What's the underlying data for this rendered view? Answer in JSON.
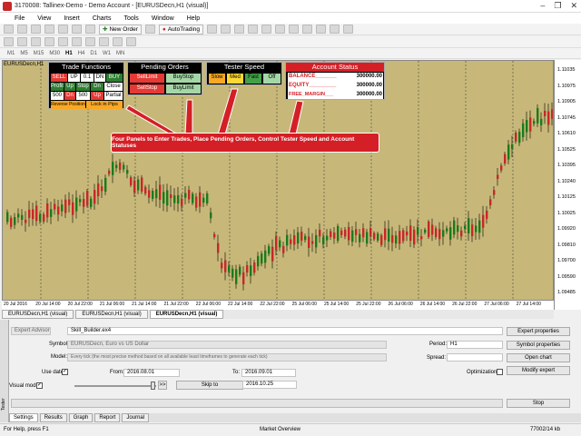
{
  "window": {
    "title": "3170008: Tallinex-Demo - Demo Account - [EURUSDecn,H1 (visual)]",
    "controls": [
      "–",
      "❐",
      "✕"
    ]
  },
  "menu": [
    "File",
    "View",
    "Insert",
    "Charts",
    "Tools",
    "Window",
    "Help"
  ],
  "toolbar": {
    "new_order": "New Order",
    "auto_trading": "AutoTrading",
    "periods": [
      "M1",
      "M5",
      "M15",
      "M30",
      "H1",
      "H4",
      "D1",
      "W1",
      "MN"
    ]
  },
  "chart": {
    "symbol_label": "EURUSDecn,H1",
    "price_labels": [
      "1.11035",
      "1.10975",
      "1.10905",
      "1.10745",
      "1.10610",
      "1.10525",
      "1.10395",
      "1.10240",
      "1.10125",
      "1.10025",
      "1.09920",
      "1.09810",
      "1.09700",
      "1.09590",
      "1.09485"
    ],
    "time_labels": [
      "20 Jul 2016",
      "20 Jul 14:00",
      "20 Jul 22:00",
      "21 Jul 06:00",
      "21 Jul 14:00",
      "21 Jul 22:00",
      "22 Jul 06:00",
      "22 Jul 14:00",
      "22 Jul 22:00",
      "25 Jul 06:00",
      "25 Jul 14:00",
      "25 Jul 22:00",
      "26 Jul 06:00",
      "26 Jul 14:00",
      "26 Jul 22:00",
      "27 Jul 06:00",
      "27 Jul 14:00"
    ],
    "bg_color": "#c7b879"
  },
  "panels": {
    "trade": {
      "title": "Trade Functions",
      "sell": "SELL",
      "lot_up": "UP",
      "lot_value": "0.1",
      "lot_dn": "DN",
      "buy": "BUY",
      "profit": "Profit",
      "up": "Up",
      "stop": "Stop",
      "dn": "Dn",
      "close": "Close",
      "tp_value": "500",
      "sl_value": "500",
      "partial": "Partial",
      "reverse": "Reverse Position",
      "lock": "Lock in Pips"
    },
    "pending": {
      "title": "Pending Orders",
      "sell_limit": "SellLimit",
      "buy_stop": "BuyStop",
      "sell_stop": "SellStop",
      "buy_limit": "BuyLimit"
    },
    "tester": {
      "title": "Tester Speed",
      "slow": "Slow",
      "med": "Med",
      "fast": "Fast",
      "off": "Off"
    },
    "account": {
      "title": "Account Status",
      "balance_label": "BALANCE_______",
      "balance_value": "300000.00",
      "equity_label": "EQUITY_________",
      "equity_value": "300000.00",
      "free_label": "FREE_MARGIN___",
      "free_value": "300000.00"
    }
  },
  "annotation": "Four Panels to Enter Trades, Place Pending Orders, Control Tester Speed and Account Statuses",
  "chart_tabs": [
    "EURUSDecn,H1 (visual)",
    "EURUSDecn,H1 (visual)",
    "EURUSDecn,H1 (visual)"
  ],
  "tester": {
    "mode": "Expert Advisor",
    "expert": "Skill_Builder.ex4",
    "symbol_label": "Symbol:",
    "symbol": "EURUSDecn, Euro vs US Dollar",
    "model_label": "Model:",
    "model": "Every tick (the most precise method based on all available least timeframes to generate each tick)",
    "use_date": "Use date",
    "from_label": "From:",
    "from": "2016.08.01",
    "to_label": "To:",
    "to": "2016.09.01",
    "visual_mode": "Visual mode",
    "skip_to": "Skip to",
    "skip_date": "2016.10.25",
    "period_label": "Period:",
    "period": "H1",
    "spread_label": "Spread:",
    "optimization": "Optimization",
    "expert_properties": "Expert properties",
    "symbol_properties": "Symbol properties",
    "open_chart": "Open chart",
    "modify_expert": "Modify expert",
    "stop": "Stop",
    "pause": ">>",
    "tabs": [
      "Settings",
      "Results",
      "Graph",
      "Report",
      "Journal"
    ],
    "toolbox_label": "Tester"
  },
  "status": {
    "help": "For Help, press F1",
    "profile": "Market Overview",
    "traffic": "77002/14 kb"
  }
}
